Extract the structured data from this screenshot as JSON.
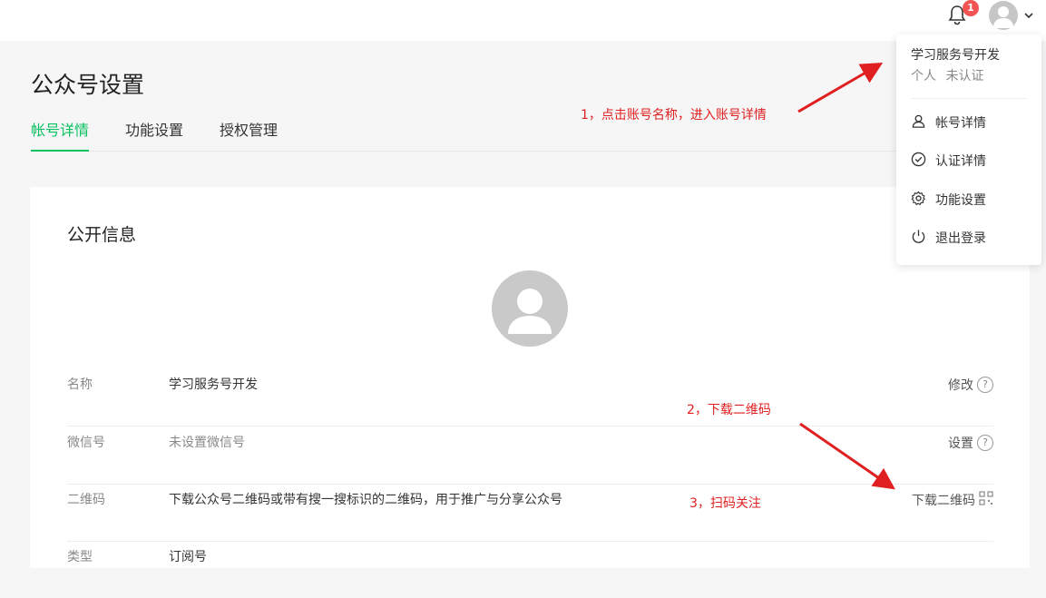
{
  "header": {
    "notification_count": "1"
  },
  "page": {
    "title": "公众号设置",
    "tabs": [
      {
        "label": "帐号详情",
        "active": true
      },
      {
        "label": "功能设置",
        "active": false
      },
      {
        "label": "授权管理",
        "active": false
      }
    ]
  },
  "section": {
    "title": "公开信息",
    "rows": [
      {
        "label": "名称",
        "value": "学习服务号开发",
        "action": "修改"
      },
      {
        "label": "微信号",
        "value": "未设置微信号",
        "action": "设置"
      },
      {
        "label": "二维码",
        "value": "下载公众号二维码或带有搜一搜标识的二维码，用于推广与分享公众号",
        "action": "下载二维码"
      },
      {
        "label": "类型",
        "value": "订阅号"
      }
    ]
  },
  "dropdown": {
    "account_name": "学习服务号开发",
    "account_sub": "个人 未认证",
    "items": [
      {
        "label": "帐号详情",
        "icon": "user-icon"
      },
      {
        "label": "认证详情",
        "icon": "check-circle-icon"
      },
      {
        "label": "功能设置",
        "icon": "gear-icon"
      },
      {
        "label": "退出登录",
        "icon": "power-icon"
      }
    ]
  },
  "annotations": [
    "1，点击账号名称，进入账号详情",
    "2，下载二维码",
    "3，扫码关注"
  ],
  "colors": {
    "accent": "#07c160",
    "annotation": "#e02020",
    "badge": "#f25454"
  }
}
